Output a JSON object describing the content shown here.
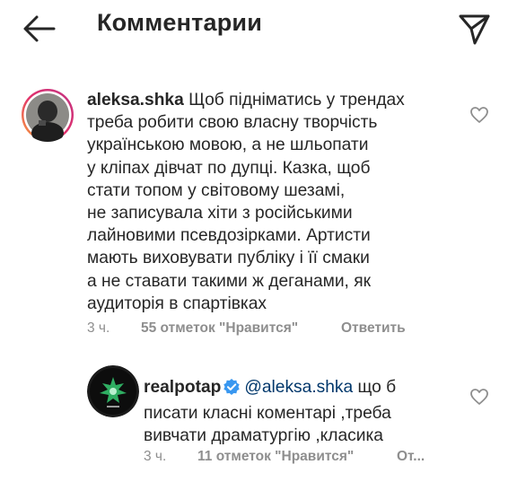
{
  "header": {
    "title": "Комментарии"
  },
  "comments": [
    {
      "username": "aleksa.shka",
      "text": "Щоб підніматись у трендах\nтреба робити свою власну творчість\nукраїнською мовою, а не шльопати\nу кліпах дівчат по дупці. Казка, щоб\nстати топом у світовому шезамі,\nне записувала хіти з російськими\nлайновими псевдозірками. Артисти\nмають виховувати публіку і її смаки\nа не ставати такими ж деганами, як\nаудиторія в спартівках",
      "time": "3 ч.",
      "likes": "55 отметок \"Нравится\"",
      "reply_label": "Ответить"
    },
    {
      "username": "realpotap",
      "mention": "@aleksa.shka",
      "text_first": "що б",
      "text": "писати класні коментарі ,треба\nвивчати драматургію ,класика",
      "time": "3 ч.",
      "likes": "11 отметок \"Нравится\"",
      "reply_label": "От..."
    }
  ],
  "icons": {
    "back": "arrow-left-icon",
    "send": "paper-plane-icon",
    "like": "heart-outline-icon",
    "verified": "verified-badge-icon"
  },
  "colors": {
    "text": "#262626",
    "secondary": "#8e8e8e",
    "mention": "#00376b",
    "verified": "#3897f0"
  }
}
